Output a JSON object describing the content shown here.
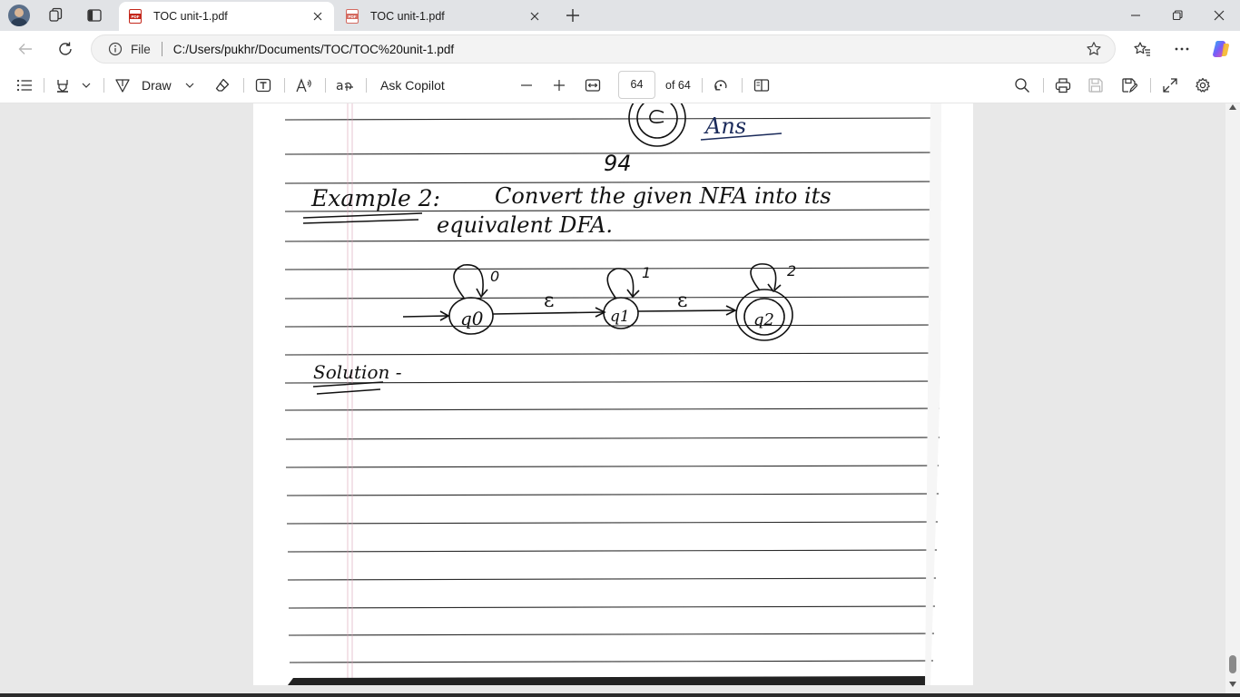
{
  "tabs": [
    {
      "title": "TOC unit-1.pdf",
      "active": true
    },
    {
      "title": "TOC unit-1.pdf",
      "active": false
    }
  ],
  "address": {
    "protocol_label": "File",
    "url": "C:/Users/pukhr/Documents/TOC/TOC%20unit-1.pdf"
  },
  "pdf_toolbar": {
    "draw_label": "Draw",
    "ask_copilot_label": "Ask Copilot",
    "read_aloud_icon_text": "A⁾",
    "translate_icon_text": "aअ",
    "current_page": "64",
    "page_total": "of 64"
  },
  "document": {
    "note_top": "Ans",
    "page_marker": "94",
    "example_heading": "Example 2:",
    "example_text_line1": "Convert the given NFA into its",
    "example_text_line2": "equivalent DFA.",
    "states": [
      "q0",
      "q1",
      "q2"
    ],
    "self_loop_labels": [
      "0",
      "1",
      "2"
    ],
    "transition_labels": [
      "ε",
      "ε"
    ],
    "solution_label": "Solution -"
  },
  "colors": {
    "edge_accent": "#1a73e8",
    "copilot": "#7a5af8"
  }
}
